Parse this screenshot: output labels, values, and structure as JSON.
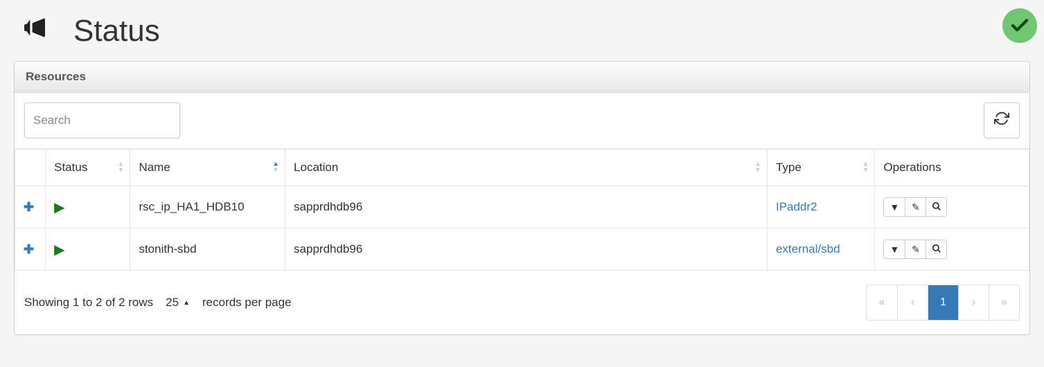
{
  "page": {
    "title": "Status"
  },
  "status_indicator": {
    "state": "ok"
  },
  "panel": {
    "title": "Resources"
  },
  "toolbar": {
    "search_placeholder": "Search"
  },
  "columns": {
    "status": "Status",
    "name": "Name",
    "location": "Location",
    "type": "Type",
    "operations": "Operations"
  },
  "sort": {
    "column": "name",
    "direction": "asc"
  },
  "rows": [
    {
      "status": "running",
      "name": "rsc_ip_HA1_HDB10",
      "location": "sapprdhdb96",
      "type": "IPaddr2"
    },
    {
      "status": "running",
      "name": "stonith-sbd",
      "location": "sapprdhdb96",
      "type": "external/sbd"
    }
  ],
  "footer": {
    "summary": "Showing 1 to 2 of 2 rows",
    "page_size": "25",
    "page_size_suffix": "records per page"
  },
  "pagination": {
    "first": "«",
    "prev": "‹",
    "current": "1",
    "next": "›",
    "last": "»"
  }
}
